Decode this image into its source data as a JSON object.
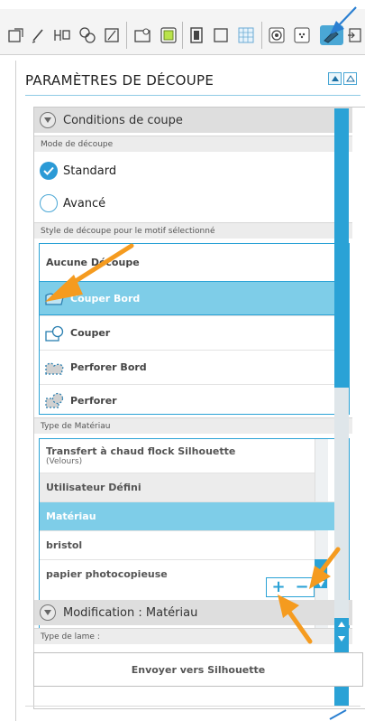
{
  "panel": {
    "title": "PARAMÈTRES DE DÉCOUPE"
  },
  "conditions": {
    "header": "Conditions de coupe",
    "mode_label": "Mode de découpe",
    "mode_options": [
      {
        "label": "Standard",
        "selected": true
      },
      {
        "label": "Avancé",
        "selected": false
      }
    ],
    "style_label": "Style de découpe pour le motif sélectionné",
    "styles": [
      {
        "label": "Aucune Découpe",
        "icon": "none",
        "selected": false
      },
      {
        "label": "Couper Bord",
        "icon": "cut-edge-icon",
        "selected": true
      },
      {
        "label": "Couper",
        "icon": "cut-icon",
        "selected": false
      },
      {
        "label": "Perforer Bord",
        "icon": "perforate-edge-icon",
        "selected": false
      },
      {
        "label": "Perforer",
        "icon": "perforate-icon",
        "selected": false
      }
    ],
    "material_label": "Type de Matériau",
    "materials": [
      {
        "label": "Transfert à chaud flock Silhouette",
        "sub": "(Velours)",
        "selected": false
      },
      {
        "label": "Utilisateur Défini",
        "sub": "",
        "selected": false
      },
      {
        "label": "Matériau",
        "sub": "",
        "selected": true
      },
      {
        "label": "bristol",
        "sub": "",
        "selected": false
      },
      {
        "label": "papier photocopieuse",
        "sub": "",
        "selected": false
      }
    ],
    "add_symbol": "+",
    "remove_symbol": "−"
  },
  "modification": {
    "header": "Modification : Matériau",
    "blade_label": "Type de lame :"
  },
  "send_button": "Envoyer vers Silhouette",
  "colors": {
    "accent": "#2aa2d6",
    "selected_row": "#7ecde8",
    "arrow": "#f59b1f"
  }
}
